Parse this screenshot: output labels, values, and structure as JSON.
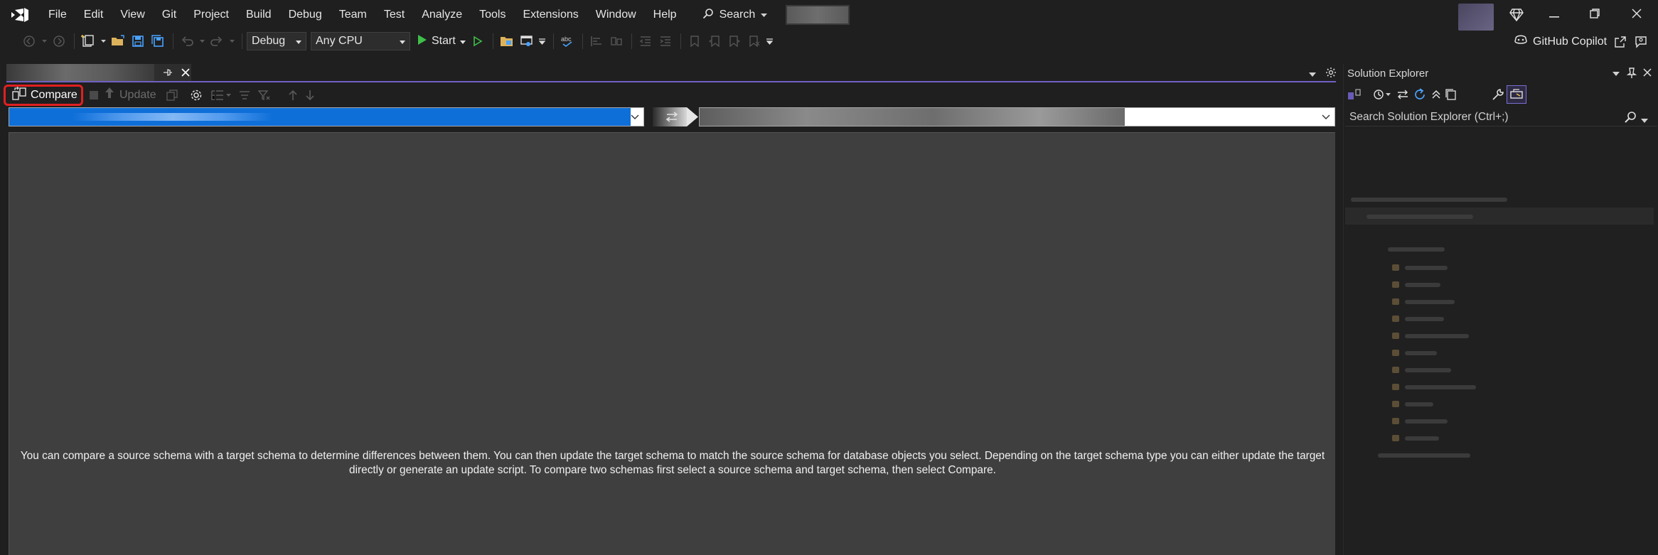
{
  "menu": {
    "items": [
      "File",
      "Edit",
      "View",
      "Git",
      "Project",
      "Build",
      "Debug",
      "Team",
      "Test",
      "Analyze",
      "Tools",
      "Extensions",
      "Window",
      "Help"
    ],
    "search_label": "Search"
  },
  "toolbar": {
    "configuration": "Debug",
    "platform": "Any CPU",
    "start_label": "Start",
    "copilot_label": "GitHub Copilot"
  },
  "schema_compare": {
    "compare_label": "Compare",
    "update_label": "Update",
    "empty_message": "You can compare a source schema with a target schema to determine differences between them.  You can then update the target schema to match the source schema for database objects you select.  Depending on the target schema type you can either update the target directly or generate an update script.  To compare two schemas first select a source schema and target schema, then select Compare."
  },
  "solution_explorer": {
    "title": "Solution Explorer",
    "search_placeholder": "Search Solution Explorer (Ctrl+;)"
  },
  "colors": {
    "accent": "#6f61c4",
    "highlight_red": "#e02020",
    "selection_blue": "#0f6fd9"
  }
}
